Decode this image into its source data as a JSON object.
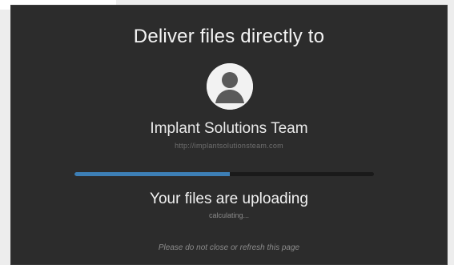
{
  "header": {
    "title": "Deliver files directly to"
  },
  "recipient": {
    "avatar_icon": "user-avatar-icon",
    "name": "Implant Solutions Team",
    "url": "http://implantsolutionsteam.com"
  },
  "upload": {
    "progress_fraction": 0.52,
    "status_title": "Your files are uploading",
    "status_detail": "calculating..."
  },
  "footer": {
    "notice": "Please do not close or refresh this page"
  },
  "colors": {
    "panel_bg": "#2c2c2c",
    "progress_fill": "#3d7fb6",
    "progress_track": "#1a1a1a"
  }
}
